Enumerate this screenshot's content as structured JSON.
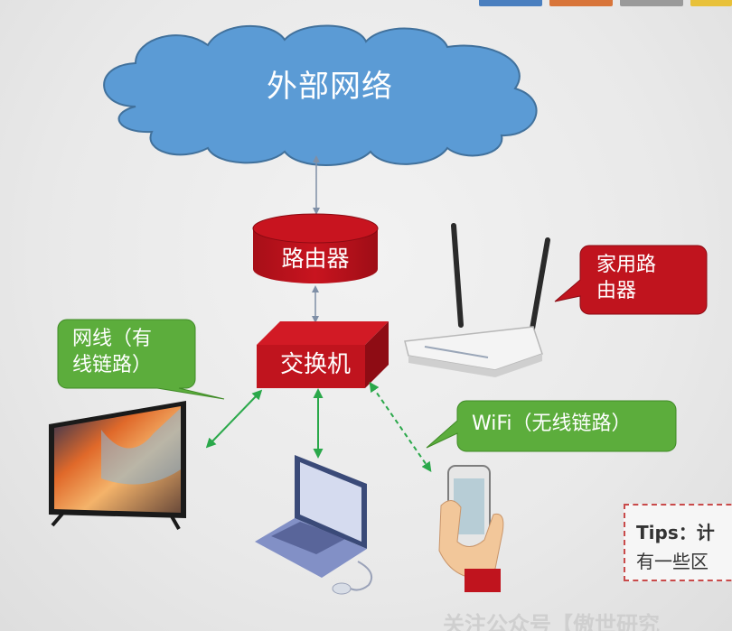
{
  "diagram": {
    "cloud_label": "外部网络",
    "router_label": "路由器",
    "switch_label": "交换机",
    "home_router_callout": [
      "家用路",
      "由器"
    ],
    "wired_callout": [
      "网线（有",
      "线链路）"
    ],
    "wifi_callout": "WiFi（无线链路）",
    "tips_title": "Tips：计",
    "tips_line2": "有一些区",
    "footer": "关注公众号【傲世研究"
  },
  "colors": {
    "cloud": "#5b9bd5",
    "device_red": "#c0141e",
    "callout_green": "#5cad3c",
    "link_green": "#2aa84a",
    "link_gray": "#7f8fa6"
  },
  "icons": [
    "cloud-icon",
    "router-cylinder-icon",
    "switch-box-icon",
    "home-router-icon",
    "tv-icon",
    "laptop-icon",
    "smartphone-icon"
  ]
}
